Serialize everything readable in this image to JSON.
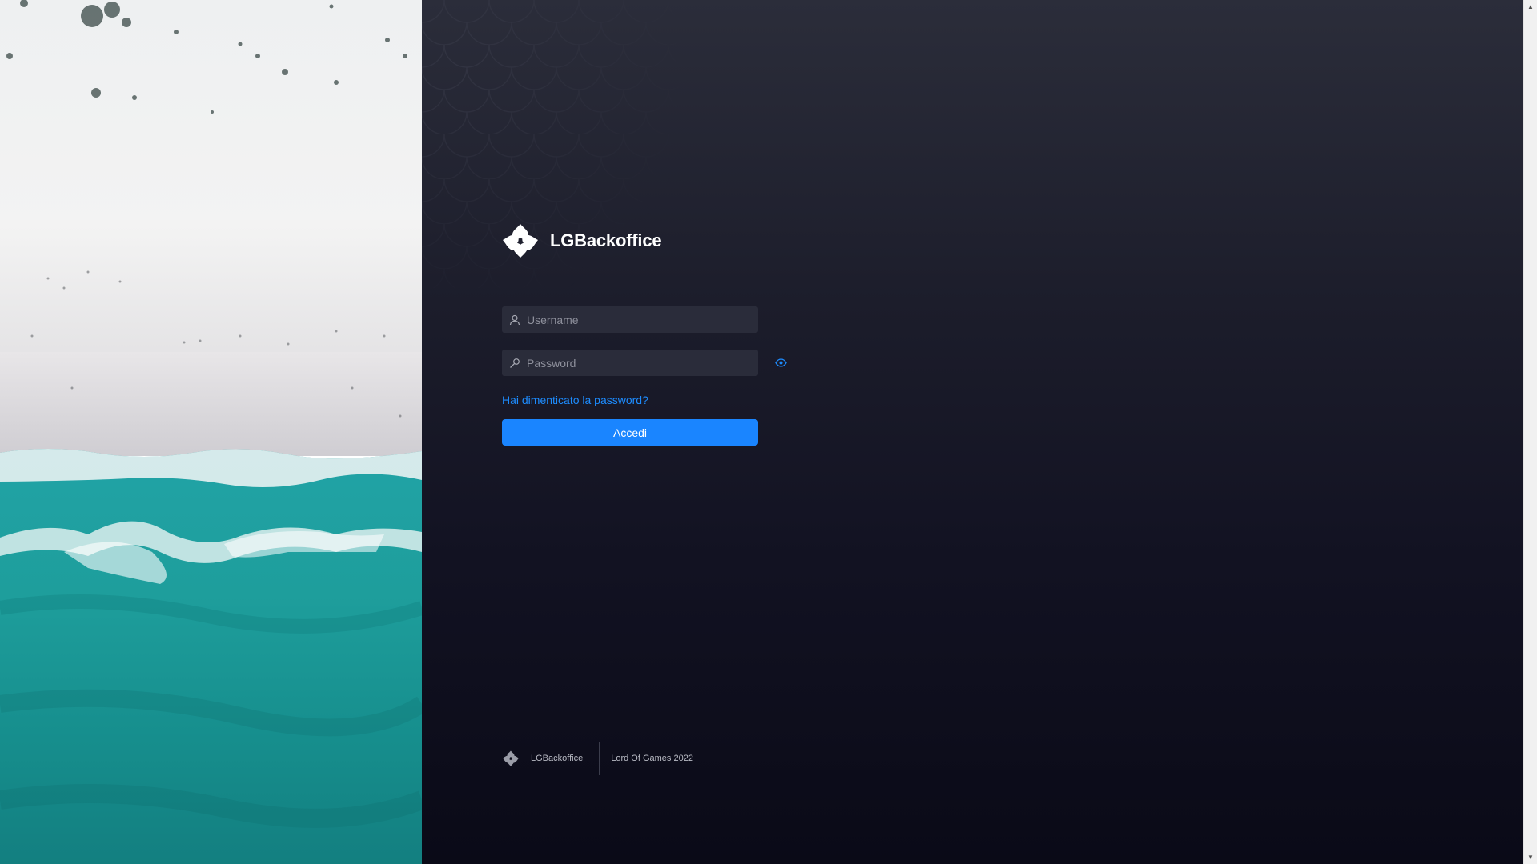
{
  "brand": {
    "name": "LGBackoffice",
    "logo_icon": "clover-logo-icon"
  },
  "login": {
    "username_placeholder": "Username",
    "username_value": "",
    "password_placeholder": "Password",
    "password_value": "",
    "username_icon": "user-icon",
    "password_icon": "key-icon",
    "toggle_icon": "eye-icon",
    "forgot_label": "Hai dimenticato la password?",
    "submit_label": "Accedi"
  },
  "footer": {
    "brand": "LGBackoffice",
    "copyright": "Lord Of Games 2022"
  },
  "colors": {
    "accent": "#1a85ff",
    "link": "#1d8cff",
    "panel_top": "#2b2d3a",
    "panel_bottom": "#0a0a17",
    "input_bg": "#2a2c3a"
  }
}
